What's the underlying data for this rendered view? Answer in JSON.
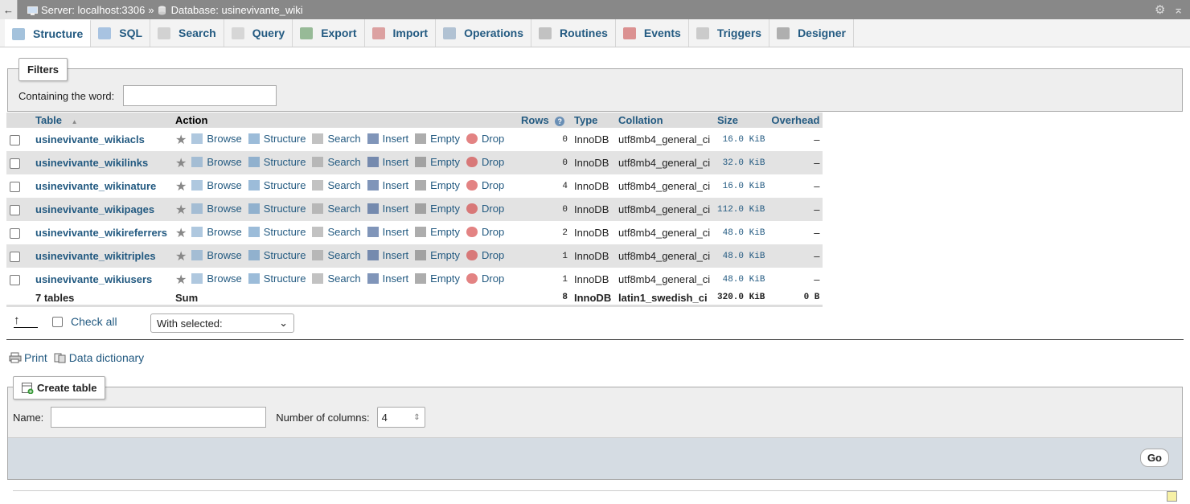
{
  "topbar": {
    "back": "←",
    "server_label": "Server: localhost:3306",
    "separator": "»",
    "database_label": "Database: usinevivante_wiki",
    "gear": "⚙",
    "collapse": "⌅"
  },
  "tabs": [
    {
      "label": "Structure",
      "icon": "structure-icon",
      "color": "#5a8fbf"
    },
    {
      "label": "SQL",
      "icon": "sql-icon",
      "color": "#6a9bd1"
    },
    {
      "label": "Search",
      "icon": "search-icon",
      "color": "#b7b7b7"
    },
    {
      "label": "Query",
      "icon": "query-icon",
      "color": "#bdbdbd"
    },
    {
      "label": "Export",
      "icon": "export-icon",
      "color": "#4b8b4b"
    },
    {
      "label": "Import",
      "icon": "import-icon",
      "color": "#c95d5d"
    },
    {
      "label": "Operations",
      "icon": "wrench-icon",
      "color": "#7a99b8"
    },
    {
      "label": "Routines",
      "icon": "routines-icon",
      "color": "#999999"
    },
    {
      "label": "Events",
      "icon": "clock-icon",
      "color": "#c74040"
    },
    {
      "label": "Triggers",
      "icon": "triggers-icon",
      "color": "#aaaaaa"
    },
    {
      "label": "Designer",
      "icon": "designer-icon",
      "color": "#777777"
    }
  ],
  "filters": {
    "legend": "Filters",
    "label": "Containing the word:",
    "value": ""
  },
  "table": {
    "headers": {
      "table": "Table",
      "sort": "▲",
      "action": "Action",
      "rows": "Rows",
      "help": "?",
      "type": "Type",
      "collation": "Collation",
      "size": "Size",
      "overhead": "Overhead"
    },
    "actions": {
      "star": "★",
      "browse": "Browse",
      "structure": "Structure",
      "search": "Search",
      "insert": "Insert",
      "empty": "Empty",
      "drop": "Drop"
    },
    "rows": [
      {
        "name": "usinevivante_wikiacls",
        "rows": "0",
        "type": "InnoDB",
        "collation": "utf8mb4_general_ci",
        "size": "16.0 KiB",
        "overhead": "–"
      },
      {
        "name": "usinevivante_wikilinks",
        "rows": "0",
        "type": "InnoDB",
        "collation": "utf8mb4_general_ci",
        "size": "32.0 KiB",
        "overhead": "–"
      },
      {
        "name": "usinevivante_wikinature",
        "rows": "4",
        "type": "InnoDB",
        "collation": "utf8mb4_general_ci",
        "size": "16.0 KiB",
        "overhead": "–"
      },
      {
        "name": "usinevivante_wikipages",
        "rows": "0",
        "type": "InnoDB",
        "collation": "utf8mb4_general_ci",
        "size": "112.0 KiB",
        "overhead": "–"
      },
      {
        "name": "usinevivante_wikireferrers",
        "rows": "2",
        "type": "InnoDB",
        "collation": "utf8mb4_general_ci",
        "size": "48.0 KiB",
        "overhead": "–"
      },
      {
        "name": "usinevivante_wikitriples",
        "rows": "1",
        "type": "InnoDB",
        "collation": "utf8mb4_general_ci",
        "size": "48.0 KiB",
        "overhead": "–"
      },
      {
        "name": "usinevivante_wikiusers",
        "rows": "1",
        "type": "InnoDB",
        "collation": "utf8mb4_general_ci",
        "size": "48.0 KiB",
        "overhead": "–"
      }
    ],
    "sum": {
      "tables": "7 tables",
      "label": "Sum",
      "rows": "8",
      "type": "InnoDB",
      "collation": "latin1_swedish_ci",
      "size": "320.0 KiB",
      "overhead": "0 B"
    }
  },
  "bulk": {
    "arrow": "↑",
    "check_all": "Check all",
    "with_selected": "With selected:",
    "chevron": "⌄"
  },
  "links": {
    "print": "Print",
    "data_dictionary": "Data dictionary"
  },
  "create_table": {
    "legend": "Create table",
    "name_label": "Name:",
    "name_value": "",
    "columns_label": "Number of columns:",
    "columns_value": "4",
    "spinner": "⇕",
    "go": "Go"
  }
}
